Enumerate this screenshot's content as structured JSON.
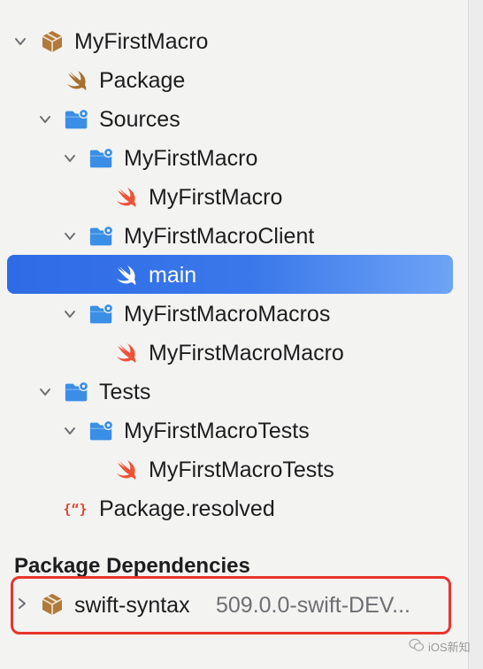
{
  "tree": {
    "items": [
      {
        "label": "MyFirstMacro",
        "icon": "package-icon"
      },
      {
        "label": "Package",
        "icon": "swift-icon"
      },
      {
        "label": "Sources",
        "icon": "folder-gear-icon"
      },
      {
        "label": "MyFirstMacro",
        "icon": "folder-gear-icon"
      },
      {
        "label": "MyFirstMacro",
        "icon": "swift-icon"
      },
      {
        "label": "MyFirstMacroClient",
        "icon": "folder-gear-icon"
      },
      {
        "label": "main",
        "icon": "swift-icon",
        "selected": true
      },
      {
        "label": "MyFirstMacroMacros",
        "icon": "folder-gear-icon"
      },
      {
        "label": "MyFirstMacroMacro",
        "icon": "swift-icon"
      },
      {
        "label": "Tests",
        "icon": "folder-gear-icon"
      },
      {
        "label": "MyFirstMacroTests",
        "icon": "folder-gear-icon"
      },
      {
        "label": "MyFirstMacroTests",
        "icon": "swift-icon"
      },
      {
        "label": "Package.resolved",
        "icon": "json-braces-icon"
      }
    ]
  },
  "dependencies": {
    "title": "Package Dependencies",
    "items": [
      {
        "name": "swift-syntax",
        "version": "509.0.0-swift-DEV...",
        "icon": "package-icon"
      }
    ]
  },
  "watermark": {
    "text": "iOS新知",
    "icon": "wechat-icon"
  },
  "colors": {
    "selection": "#2e6be6",
    "folder": "#3a8ee6",
    "swift": "#f05138",
    "package": "#b07a3c",
    "highlight_box": "#e8352c"
  }
}
